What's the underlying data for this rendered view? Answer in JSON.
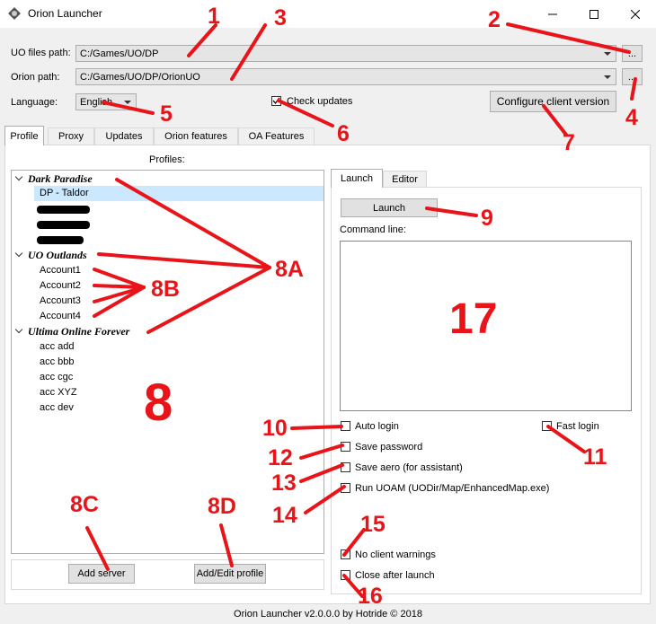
{
  "window": {
    "title": "Orion Launcher"
  },
  "top": {
    "uo_files_label": "UO files path:",
    "uo_files_value": "C:/Games/UO/DP",
    "orion_label": "Orion path:",
    "orion_value": "C:/Games/UO/DP/OrionUO",
    "browse_label": "...",
    "language_label": "Language:",
    "language_value": "English",
    "check_updates_label": "Check updates",
    "configure_label": "Configure client version"
  },
  "tabs": [
    "Profile",
    "Proxy",
    "Updates",
    "Orion features",
    "OA Features"
  ],
  "profiles": {
    "header": "Profiles:",
    "groups": [
      {
        "name": "Dark Paradise",
        "items": [
          "DP - Taldor"
        ]
      },
      {
        "name": "UO Outlands",
        "items": [
          "Account1",
          "Account2",
          "Account3",
          "Account4"
        ]
      },
      {
        "name": "Ultima Online Forever",
        "items": [
          "acc add",
          "acc bbb",
          "acc cgc",
          "acc XYZ",
          "acc dev"
        ]
      }
    ],
    "add_server_label": "Add server",
    "add_edit_label": "Add/Edit profile"
  },
  "launch": {
    "tabs": [
      "Launch",
      "Editor"
    ],
    "launch_button": "Launch",
    "command_line_label": "Command line:",
    "options": {
      "auto_login": "Auto login",
      "fast_login": "Fast login",
      "save_password": "Save password",
      "save_aero": "Save aero (for assistant)",
      "run_uoam": "Run UOAM (UODir/Map/EnhancedMap.exe)",
      "no_client_warnings": "No client warnings",
      "close_after_launch": "Close after launch"
    }
  },
  "footer": "Orion Launcher v2.0.0.0 by Hotride © 2018",
  "annotations": [
    "1",
    "2",
    "3",
    "4",
    "5",
    "6",
    "7",
    "8",
    "8A",
    "8B",
    "8C",
    "8D",
    "9",
    "10",
    "11",
    "12",
    "13",
    "14",
    "15",
    "16",
    "17"
  ],
  "colors": {
    "annotation": "#e8141a",
    "selection": "#cce8ff"
  }
}
